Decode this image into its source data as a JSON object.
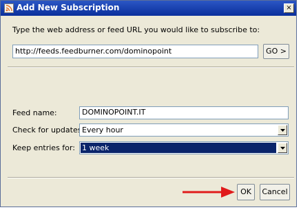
{
  "dialog": {
    "title": "Add New Subscription",
    "close_label": "×"
  },
  "prompt": "Type the web address or feed URL you would like to subscribe to:",
  "url": {
    "value": "http://feeds.feedburner.com/dominopoint"
  },
  "go_label": "GO >",
  "fields": {
    "feed_name_label": "Feed name:",
    "feed_name_value": "DOMINOPOINT.IT",
    "check_label": "Check for updates:",
    "check_value": "Every hour",
    "keep_label": "Keep entries for:",
    "keep_value": "1 week"
  },
  "buttons": {
    "ok": "OK",
    "cancel": "Cancel"
  },
  "colors": {
    "title_bar": "#0a2f9c",
    "selection": "#0a246a",
    "annotation_arrow": "#e01b1b",
    "dialog_bg": "#ece9d8"
  },
  "icons": {
    "app": "rss-feed-icon",
    "annotation": "red-arrow-icon"
  }
}
